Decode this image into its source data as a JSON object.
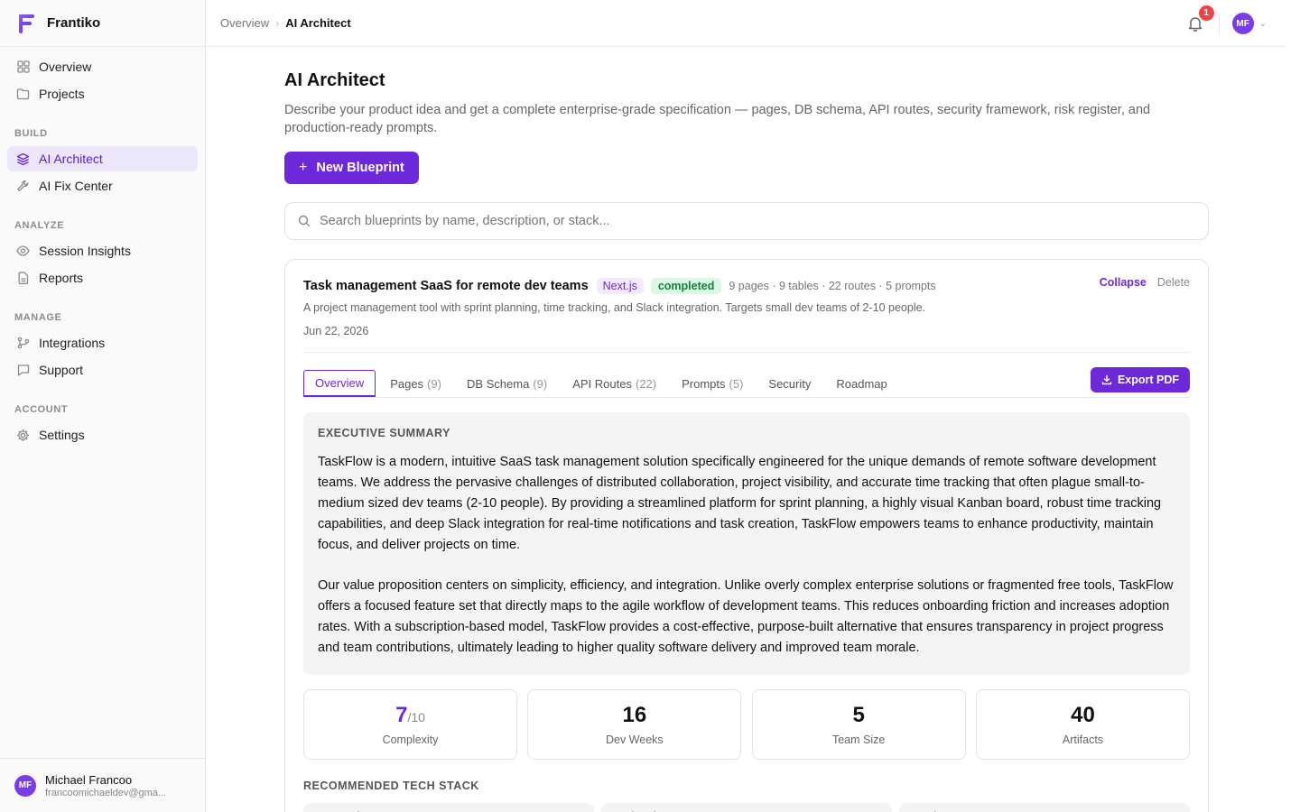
{
  "app": {
    "name": "Frantiko",
    "brand_color": "#6d28d9"
  },
  "sidebar": {
    "top_items": [
      {
        "label": "Overview",
        "icon": "grid-icon"
      },
      {
        "label": "Projects",
        "icon": "folder-icon"
      }
    ],
    "sections": [
      {
        "label": "BUILD",
        "items": [
          {
            "label": "AI Architect",
            "icon": "layers-icon",
            "active": true
          },
          {
            "label": "AI Fix Center",
            "icon": "wrench-icon"
          }
        ]
      },
      {
        "label": "ANALYZE",
        "items": [
          {
            "label": "Session Insights",
            "icon": "eye-icon"
          },
          {
            "label": "Reports",
            "icon": "file-icon"
          }
        ]
      },
      {
        "label": "MANAGE",
        "items": [
          {
            "label": "Integrations",
            "icon": "git-branch-icon"
          },
          {
            "label": "Support",
            "icon": "message-icon"
          }
        ]
      },
      {
        "label": "ACCOUNT",
        "items": [
          {
            "label": "Settings",
            "icon": "gear-icon"
          }
        ]
      }
    ],
    "user": {
      "initials": "MF",
      "name": "Michael Francoo",
      "email": "francoomichaeldev@gma..."
    }
  },
  "topbar": {
    "breadcrumb": [
      "Overview",
      "AI Architect"
    ],
    "notifications": "1",
    "avatar_initials": "MF"
  },
  "main": {
    "title": "AI Architect",
    "description": "Describe your product idea and get a complete enterprise-grade specification — pages, DB schema, API routes, security framework, risk register, and production-ready prompts.",
    "new_button": "New Blueprint",
    "search_placeholder": "Search blueprints by name, description, or stack...",
    "blueprint": {
      "title": "Task management SaaS for remote dev teams",
      "stack": "Next.js",
      "status": "completed",
      "meta": "9 pages · 9 tables · 22 routes · 5 prompts",
      "collapse": "Collapse",
      "delete": "Delete",
      "description": "A project management tool with sprint planning, time tracking, and Slack integration. Targets small dev teams of 2-10 people.",
      "date": "Jun 22, 2026",
      "tabs": [
        {
          "label": "Overview",
          "count": "",
          "active": true
        },
        {
          "label": "Pages",
          "count": "(9)"
        },
        {
          "label": "DB Schema",
          "count": "(9)"
        },
        {
          "label": "API Routes",
          "count": "(22)"
        },
        {
          "label": "Prompts",
          "count": "(5)"
        },
        {
          "label": "Security",
          "count": ""
        },
        {
          "label": "Roadmap",
          "count": ""
        }
      ],
      "export": "Export PDF",
      "summary_label": "EXECUTIVE SUMMARY",
      "summary_p1": "TaskFlow is a modern, intuitive SaaS task management solution specifically engineered for the unique demands of remote software development teams. We address the pervasive challenges of distributed collaboration, project visibility, and accurate time tracking that often plague small-to-medium sized dev teams (2-10 people). By providing a streamlined platform for sprint planning, a highly visual Kanban board, robust time tracking capabilities, and deep Slack integration for real-time notifications and task creation, TaskFlow empowers teams to enhance productivity, maintain focus, and deliver projects on time.",
      "summary_p2": "Our value proposition centers on simplicity, efficiency, and integration. Unlike overly complex enterprise solutions or fragmented free tools, TaskFlow offers a focused feature set that directly maps to the agile workflow of development teams. This reduces onboarding friction and increases adoption rates. With a subscription-based model, TaskFlow provides a cost-effective, purpose-built alternative that ensures transparency in project progress and team contributions, ultimately leading to higher quality software delivery and improved team morale.",
      "stats": {
        "complexity_value": "7",
        "complexity_denom": "/10",
        "complexity_label": "Complexity",
        "dev_weeks_value": "16",
        "dev_weeks_label": "Dev Weeks",
        "team_size_value": "5",
        "team_size_label": "Team Size",
        "artifacts_value": "40",
        "artifacts_label": "Artifacts"
      },
      "tech_label": "RECOMMENDED TECH STACK",
      "tech": [
        "Frontend",
        "Backend",
        "Database"
      ]
    }
  }
}
